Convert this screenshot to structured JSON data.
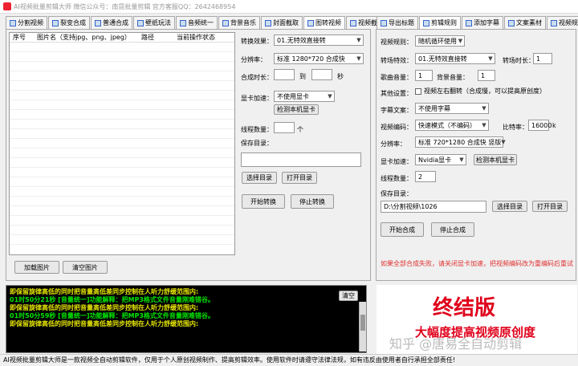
{
  "title": "AI视频批量剪辑大师    微信公众号：南昆批量剪辑    官方客服QQ：2642468954",
  "left_tabs": [
    "分割视频",
    "裂变合成",
    "普通合成",
    "壁纸玩法",
    "音频统一",
    "背景音乐",
    "封面截取",
    "图转视频",
    "视频截图"
  ],
  "right_tabs": [
    "导出标题",
    "剪辑规则",
    "添加字幕",
    "文案素材",
    "视频规则"
  ],
  "table": {
    "headers": [
      "序号",
      "图片名（支持jpg、png、jpeg）",
      "路径",
      "当前操作状态"
    ]
  },
  "left_buttons": {
    "load": "加载图片",
    "clear": "清空图片"
  },
  "conv": {
    "effect_label": "转换效果：",
    "effect_value": "01.无特效直接转",
    "res_label": "分辨率：",
    "res_value": "标准 1280*720 合成快",
    "dur_label": "合成时长：",
    "to": "到",
    "sec": "秒",
    "gpu_label": "显卡加速：",
    "gpu_value": "不使用显卡",
    "detect": "检测本机显卡",
    "thread_label": "线程数量：",
    "thread_unit": "个",
    "save_label": "保存目录：",
    "choose": "选择目录",
    "open": "打开目录",
    "start": "开始转换",
    "stop": "停止转换"
  },
  "rules": {
    "rule_label": "视频规则：",
    "rule_value": "随机循环使用",
    "fx_label": "转场特效：",
    "fx_value": "01.无特效直接转",
    "fxdur_label": "转场时长：",
    "fxdur_value": "1",
    "song_label": "歌曲音量：",
    "song_value": "1",
    "bg_label": "背景音量：",
    "bg_value": "1",
    "other_label": "其他设置：",
    "other_check": "视频左右翻转（合成慢，可以提高原创度）",
    "sub_label": "字幕文案：",
    "sub_value": "不使用字幕",
    "enc_label": "视频编码：",
    "enc_value": "快速模式（不编码）",
    "rate_label": "比特率：",
    "rate_value": "16000",
    "rate_unit": "k",
    "res_label": "分辨率：",
    "res_value": "标准 720*1280 合成快 竖版",
    "gpu_label": "显卡加速：",
    "gpu_value": "Nvidia显卡",
    "detect": "检测本机显卡",
    "thread_label": "线程数量：",
    "thread_value": "2",
    "save_label": "保存目录：",
    "save_value": "D:\\分割视频\\1026",
    "choose": "选择目录",
    "open": "打开目录",
    "start": "开始合成",
    "stop": "停止合成",
    "warn": "如果全部合成失败，请关闭显卡加速，把视频编码改为重编码后重试"
  },
  "log": {
    "lines": [
      {
        "text": "      即保留旋律高低的同时把音量高低差同步控制在人听力舒缓范围内:",
        "color": "#e6e600"
      },
      {
        "text": "01时50分21秒 [音量统一]功能解释：把MP3格式文件音量刚难错谷。",
        "color": "#00e600"
      },
      {
        "text": "      即保留旋律高低的同时把音量高低差同步控制在人听力舒缓范围内:",
        "color": "#e6e600"
      },
      {
        "text": "01时50分59秒 [音量统一]功能解释：把MP3格式文件音量刚难错谷。",
        "color": "#00e600"
      },
      {
        "text": "      即保留旋律高低的同时把音量高低差同步控制在人听力舒缓范围内:",
        "color": "#e6e600"
      }
    ],
    "clear": "清空"
  },
  "promo": {
    "big": "终结版",
    "sub": "大幅度提高视频原创度",
    "watermark": "知乎 @唐易全自动剪辑"
  },
  "status": "AI视频批量剪辑大师是一款视频全自动剪辑软件，仅用于个人原创视频制作、提高剪辑效率。使用软件时请遵守法律法规，如有违反由使用者自行承担全部责任!",
  "colors": {
    "red": "#e0001b",
    "warn": "#e03030"
  }
}
